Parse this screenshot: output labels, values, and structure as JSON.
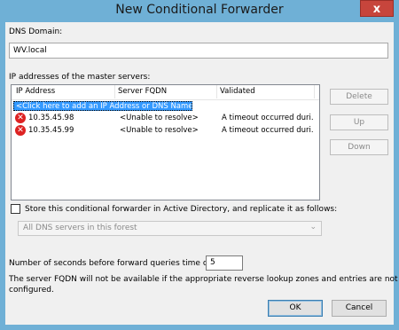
{
  "window": {
    "title": "New Conditional Forwarder",
    "close_glyph": "x"
  },
  "dns_domain": {
    "label": "DNS Domain:",
    "value": "WV.local"
  },
  "master_servers": {
    "label": "IP addresses of the master servers:",
    "columns": [
      "IP Address",
      "Server FQDN",
      "Validated"
    ],
    "add_row_text": "<Click here to add an IP Address or DNS Name>",
    "rows": [
      {
        "ip": "10.35.45.98",
        "fqdn": "<Unable to resolve>",
        "validated": "A timeout occurred duri...",
        "icon": "error-icon"
      },
      {
        "ip": "10.35.45.99",
        "fqdn": "<Unable to resolve>",
        "validated": "A timeout occurred duri...",
        "icon": "error-icon"
      }
    ]
  },
  "side_buttons": {
    "delete": "Delete",
    "up": "Up",
    "down": "Down"
  },
  "store_ad": {
    "label": "Store this conditional forwarder in Active Directory, and replicate it as follows:",
    "checked": false,
    "combo_value": "All DNS servers in this forest"
  },
  "timeout": {
    "label": "Number of seconds before forward queries time out:",
    "value": "5"
  },
  "note": {
    "line1": "The server FQDN will not be available if the appropriate reverse lookup zones and entries are not",
    "line2": "configured."
  },
  "buttons": {
    "ok": "OK",
    "cancel": "Cancel"
  }
}
